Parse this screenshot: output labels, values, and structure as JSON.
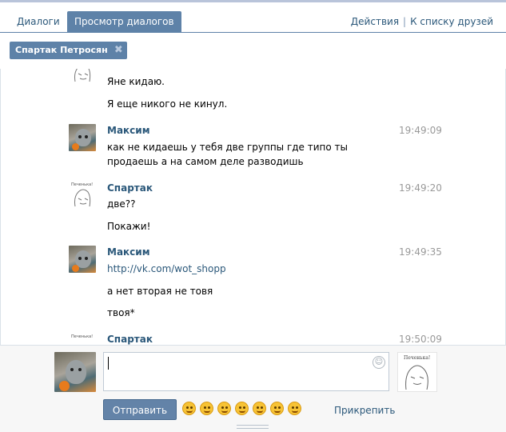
{
  "tabs": [
    {
      "label": "Диалоги",
      "active": false
    },
    {
      "label": "Просмотр диалогов",
      "active": true
    }
  ],
  "header_actions": {
    "actions": "Действия",
    "separator": "|",
    "friends": "К списку друзей"
  },
  "chip": {
    "label": "Спартак Петросян",
    "close": "✖"
  },
  "messages": [
    {
      "author": "",
      "time": "",
      "avatar": "meme-avatar",
      "lines": [
        "Яне кидаю.",
        "Я еще никого не кинул."
      ]
    },
    {
      "author": "Максим",
      "time": "19:49:09",
      "avatar": "cat-avatar",
      "lines": [
        "как не кидаешь у тебя две группы где типо ты продаешь а на самом деле разводишь"
      ]
    },
    {
      "author": "Спартак",
      "time": "19:49:20",
      "avatar": "meme-avatar",
      "lines": [
        "две??",
        "Покажи!"
      ]
    },
    {
      "author": "Максим",
      "time": "19:49:35",
      "avatar": "cat-avatar",
      "lines": [
        "http://vk.com/wot_shopp",
        "а нет вторая не товя",
        "твоя*"
      ]
    },
    {
      "author": "Спартак",
      "time": "19:50:09",
      "avatar": "meme-avatar",
      "lines": []
    }
  ],
  "composer": {
    "input_value": "",
    "send_label": "Отправить",
    "attach_label": "Прикрепить",
    "emoji_icons": [
      "wink-emoji",
      "cool-emoji",
      "grin-emoji",
      "laugh-emoji",
      "smile-emoji",
      "surprised-emoji",
      "kiss-emoji"
    ],
    "peer_avatar_caption": "Печенька!"
  },
  "colors": {
    "accent": "#5e82a8",
    "link": "#2b587a",
    "time": "#999999"
  }
}
